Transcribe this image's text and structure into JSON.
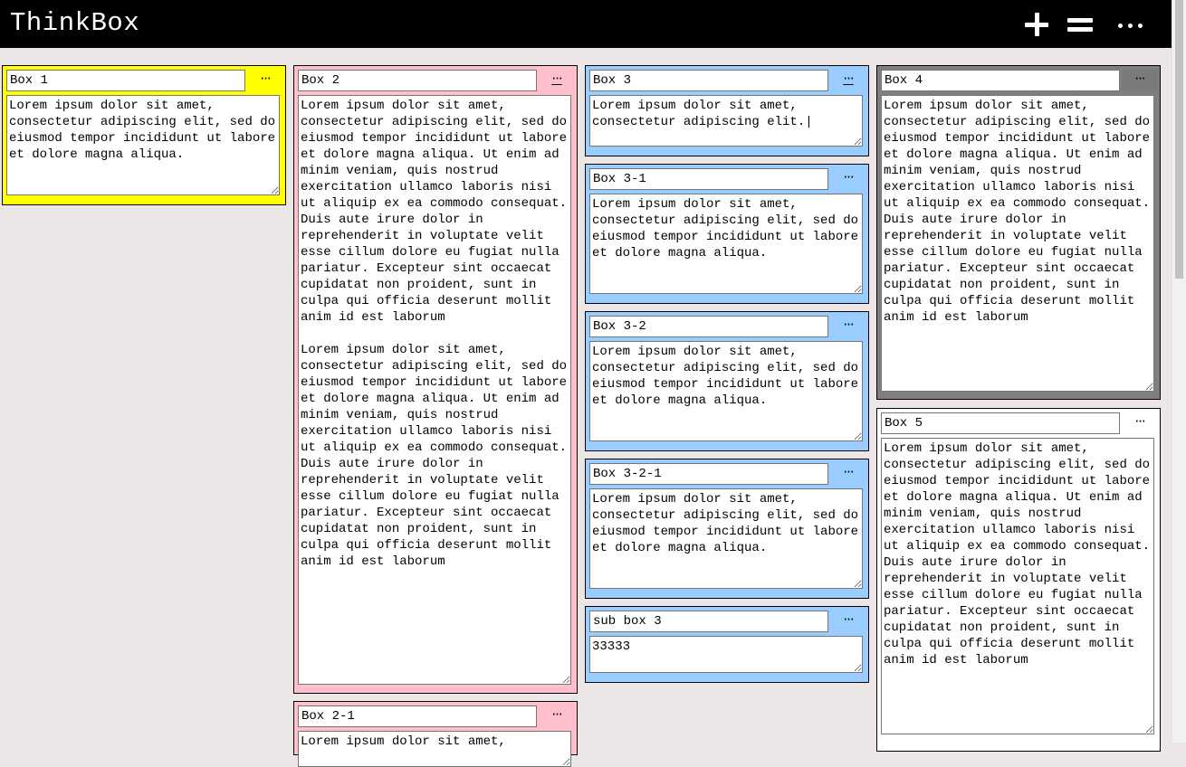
{
  "app": {
    "title": "ThinkBox"
  },
  "toolbar": {
    "add_icon": "plus-icon",
    "menu_icon": "hamburger-icon",
    "more_icon": "more-icon"
  },
  "colors": {
    "yellow": "#ffff00",
    "pink": "#ffc0cb",
    "blue": "#99ccff",
    "gray": "#7f7f7f",
    "white": "#ffffff"
  },
  "boxes": [
    {
      "title": "Box 1",
      "dots": "···",
      "text": "Lorem ipsum dolor sit amet, consectetur adipiscing elit, sed do eiusmod tempor incididunt ut labore et dolore magna aliqua."
    },
    {
      "title": "Box 2",
      "dots": "···",
      "text": "Lorem ipsum dolor sit amet, consectetur adipiscing elit, sed do eiusmod tempor incididunt ut labore et dolore magna aliqua. Ut enim ad minim veniam, quis nostrud exercitation ullamco laboris nisi ut aliquip ex ea commodo consequat. Duis aute irure dolor in reprehenderit in voluptate velit esse cillum dolore eu fugiat nulla pariatur. Excepteur sint occaecat cupidatat non proident, sunt in culpa qui officia deserunt mollit anim id est laborum\n\nLorem ipsum dolor sit amet, consectetur adipiscing elit, sed do eiusmod tempor incididunt ut labore et dolore magna aliqua. Ut enim ad minim veniam, quis nostrud exercitation ullamco laboris nisi ut aliquip ex ea commodo consequat. Duis aute irure dolor in reprehenderit in voluptate velit esse cillum dolore eu fugiat nulla pariatur. Excepteur sint occaecat cupidatat non proident, sunt in culpa qui officia deserunt mollit anim id est laborum"
    },
    {
      "title": "Box 2-1",
      "dots": "···",
      "text": "Lorem ipsum dolor sit amet,"
    },
    {
      "title": "Box 3",
      "dots": "···",
      "text": "Lorem ipsum dolor sit amet, consectetur adipiscing elit.|"
    },
    {
      "title": "Box 3-1",
      "dots": "···",
      "text": "Lorem ipsum dolor sit amet, consectetur adipiscing elit, sed do eiusmod tempor incididunt ut labore et dolore magna aliqua."
    },
    {
      "title": "Box 3-2",
      "dots": "···",
      "text": "Lorem ipsum dolor sit amet, consectetur adipiscing elit, sed do eiusmod tempor incididunt ut labore et dolore magna aliqua."
    },
    {
      "title": "Box 3-2-1",
      "dots": "···",
      "text": "Lorem ipsum dolor sit amet, consectetur adipiscing elit, sed do eiusmod tempor incididunt ut labore et dolore magna aliqua."
    },
    {
      "title": "sub box 3",
      "dots": "···",
      "text": "33333"
    },
    {
      "title": "Box 4",
      "dots": "···",
      "text": "Lorem ipsum dolor sit amet, consectetur adipiscing elit, sed do eiusmod tempor incididunt ut labore et dolore magna aliqua. Ut enim ad minim veniam, quis nostrud exercitation ullamco laboris nisi ut aliquip ex ea commodo consequat. Duis aute irure dolor in reprehenderit in voluptate velit esse cillum dolore eu fugiat nulla pariatur. Excepteur sint occaecat cupidatat non proident, sunt in culpa qui officia deserunt mollit anim id est laborum"
    },
    {
      "title": "Box 5",
      "dots": "···",
      "text": "Lorem ipsum dolor sit amet, consectetur adipiscing elit, sed do eiusmod tempor incididunt ut labore et dolore magna aliqua. Ut enim ad minim veniam, quis nostrud exercitation ullamco laboris nisi ut aliquip ex ea commodo consequat. Duis aute irure dolor in reprehenderit in voluptate velit esse cillum dolore eu fugiat nulla pariatur. Excepteur sint occaecat cupidatat non proident, sunt in culpa qui officia deserunt mollit anim id est laborum"
    }
  ]
}
